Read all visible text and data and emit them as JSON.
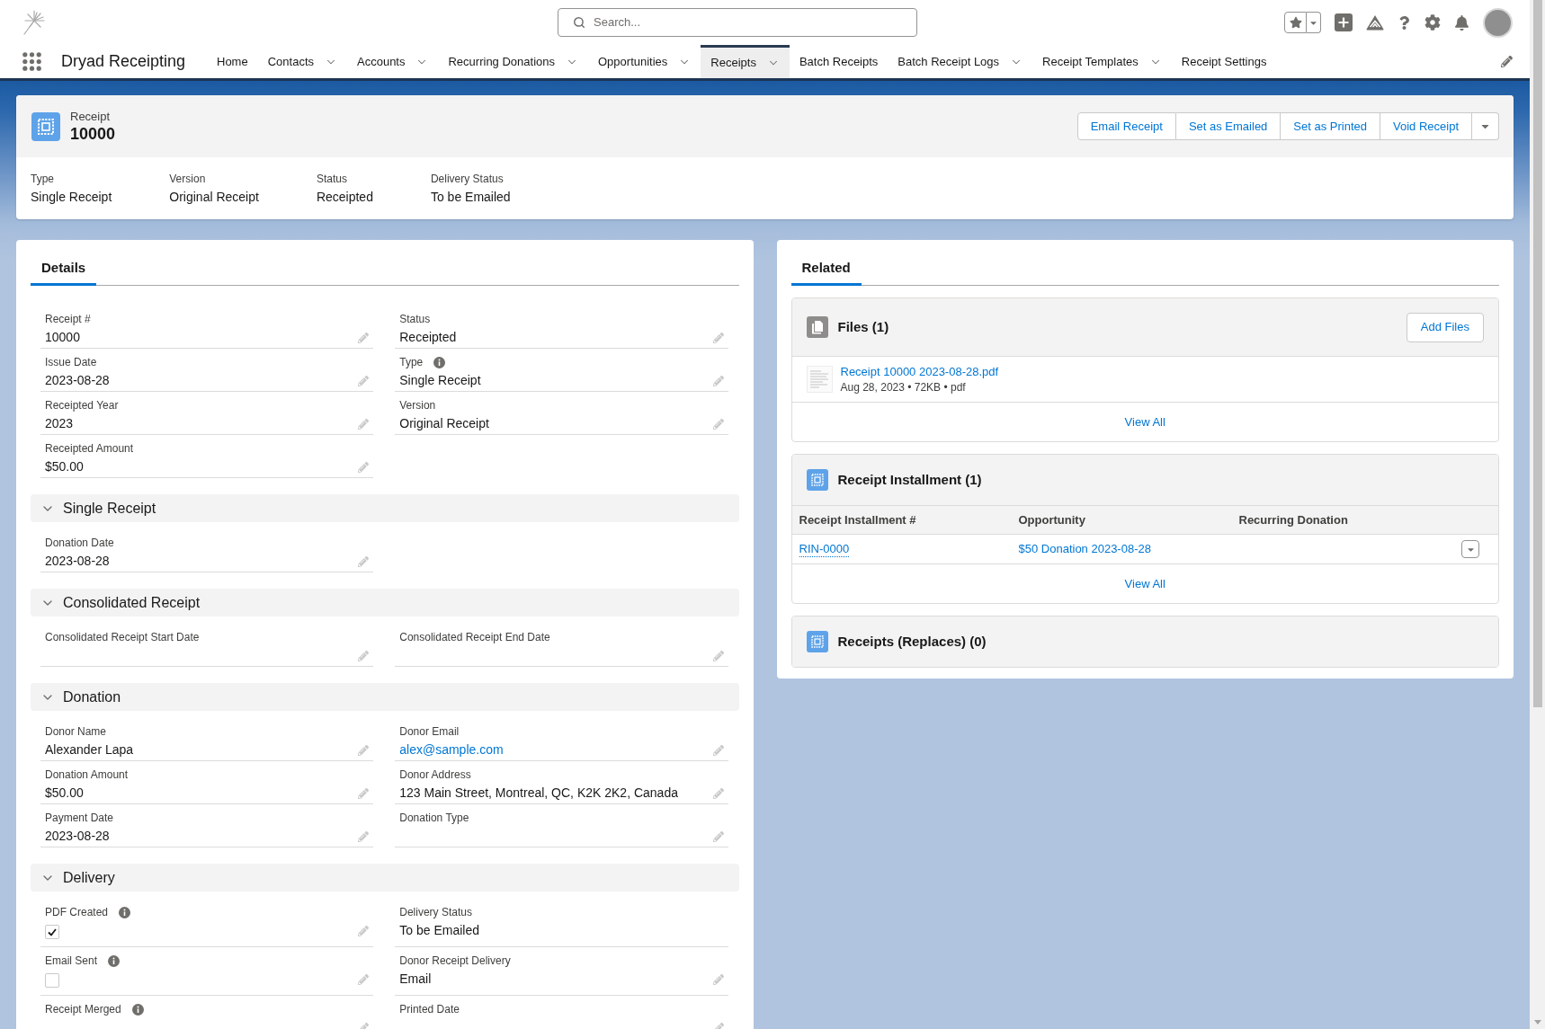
{
  "app_bar": {
    "search": {
      "placeholder": "Search..."
    }
  },
  "nav": {
    "app_name": "Dryad Receipting",
    "items": [
      {
        "label": "Home",
        "has_menu": false,
        "selected": false
      },
      {
        "label": "Contacts",
        "has_menu": true,
        "selected": false
      },
      {
        "label": "Accounts",
        "has_menu": true,
        "selected": false
      },
      {
        "label": "Recurring Donations",
        "has_menu": true,
        "selected": false
      },
      {
        "label": "Opportunities",
        "has_menu": true,
        "selected": false
      },
      {
        "label": "Receipts",
        "has_menu": true,
        "selected": true
      },
      {
        "label": "Batch Receipts",
        "has_menu": false,
        "selected": false
      },
      {
        "label": "Batch Receipt Logs",
        "has_menu": true,
        "selected": false
      },
      {
        "label": "Receipt Templates",
        "has_menu": true,
        "selected": false
      },
      {
        "label": "Receipt Settings",
        "has_menu": false,
        "selected": false
      }
    ]
  },
  "record_header": {
    "object_label": "Receipt",
    "title": "10000",
    "actions": [
      "Email Receipt",
      "Set as Emailed",
      "Set as Printed",
      "Void Receipt"
    ],
    "highlights": [
      {
        "label": "Type",
        "value": "Single Receipt"
      },
      {
        "label": "Version",
        "value": "Original Receipt"
      },
      {
        "label": "Status",
        "value": "Receipted"
      },
      {
        "label": "Delivery Status",
        "value": "To be Emailed"
      }
    ]
  },
  "details_panel": {
    "tabs": [
      {
        "label": "Details",
        "selected": true
      }
    ],
    "fields": [
      {
        "label": "Receipt #",
        "kind": "text",
        "value": "10000",
        "info": false,
        "editable": true
      },
      {
        "label": "Status",
        "kind": "text",
        "value": "Receipted",
        "info": false,
        "editable": true
      },
      {
        "label": "Issue Date",
        "kind": "text",
        "value": "2023-08-28",
        "info": false,
        "editable": true
      },
      {
        "label": "Type",
        "kind": "text",
        "value": "Single Receipt",
        "info": true,
        "editable": true
      },
      {
        "label": "Receipted Year",
        "kind": "text",
        "value": "2023",
        "info": false,
        "editable": true
      },
      {
        "label": "Version",
        "kind": "text",
        "value": "Original Receipt",
        "info": false,
        "editable": true
      },
      {
        "label": "Receipted Amount",
        "kind": "text",
        "value": "$50.00",
        "info": false,
        "editable": true
      }
    ],
    "sections": [
      {
        "title": "Single Receipt",
        "expanded": true,
        "fields": [
          {
            "label": "Donation Date",
            "kind": "text",
            "value": "2023-08-28",
            "info": false,
            "editable": true
          }
        ]
      },
      {
        "title": "Consolidated Receipt",
        "expanded": true,
        "fields": [
          {
            "label": "Consolidated Receipt Start Date",
            "kind": "text",
            "info": false,
            "editable": true
          },
          {
            "label": "Consolidated Receipt End Date",
            "kind": "text",
            "info": false,
            "editable": true
          }
        ]
      },
      {
        "title": "Donation",
        "expanded": true,
        "fields": [
          {
            "label": "Donor Name",
            "kind": "text",
            "value": "Alexander Lapa",
            "info": false,
            "editable": true
          },
          {
            "label": "Donor Email",
            "kind": "link",
            "value": "alex@sample.com",
            "info": false,
            "editable": true
          },
          {
            "label": "Donation Amount",
            "kind": "text",
            "value": "$50.00",
            "info": false,
            "editable": true
          },
          {
            "label": "Donor Address",
            "kind": "text",
            "value": "123 Main Street, Montreal, QC, K2K 2K2, Canada",
            "info": false,
            "editable": true
          },
          {
            "label": "Payment Date",
            "kind": "text",
            "value": "2023-08-28",
            "info": false,
            "editable": true
          },
          {
            "label": "Donation Type",
            "kind": "text",
            "info": false,
            "editable": true
          }
        ]
      },
      {
        "title": "Delivery",
        "expanded": true,
        "fields": [
          {
            "label": "PDF Created",
            "kind": "checkbox",
            "checked": true,
            "info": true,
            "editable": true
          },
          {
            "label": "Delivery Status",
            "kind": "text",
            "value": "To be Emailed",
            "info": false,
            "editable": false
          },
          {
            "label": "Email Sent",
            "kind": "checkbox",
            "checked": false,
            "info": true,
            "editable": true
          },
          {
            "label": "Donor Receipt Delivery",
            "kind": "text",
            "value": "Email",
            "info": false,
            "editable": true
          },
          {
            "label": "Receipt Merged",
            "kind": "text",
            "info": true,
            "editable": true
          },
          {
            "label": "Printed Date",
            "kind": "text",
            "info": false,
            "editable": true
          }
        ]
      }
    ]
  },
  "related_panel": {
    "tabs": [
      {
        "label": "Related",
        "selected": true
      }
    ],
    "cards": [
      {
        "kind": "files",
        "title": "Files (1)",
        "action": "Add Files",
        "files": [
          {
            "name": "Receipt 10000 2023-08-28.pdf",
            "meta": "Aug 28, 2023 • 72KB • pdf"
          }
        ],
        "view_all": "View All"
      },
      {
        "kind": "list",
        "title": "Receipt Installment (1)",
        "columns": [
          "Receipt Installment #",
          "Opportunity",
          "Recurring Donation"
        ],
        "rows": [
          {
            "cells": [
              {
                "kind": "record_link",
                "text": "RIN-0000"
              },
              {
                "kind": "link",
                "text": "$50 Donation 2023-08-28"
              }
            ]
          }
        ],
        "view_all": "View All"
      },
      {
        "kind": "list",
        "title": "Receipts (Replaces) (0)"
      }
    ]
  }
}
